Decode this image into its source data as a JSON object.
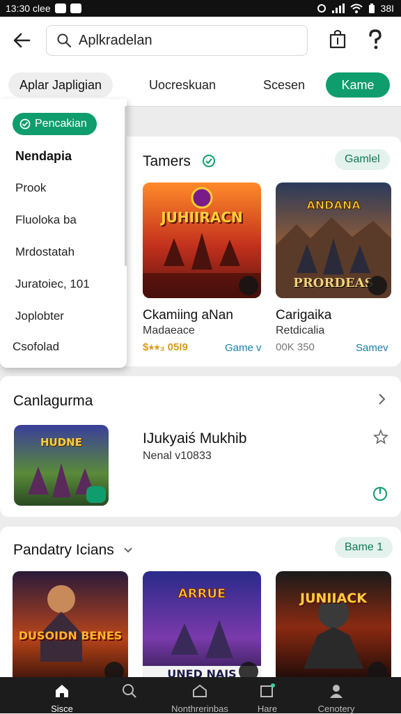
{
  "status": {
    "time": "13:30 clee",
    "battery": "38I"
  },
  "search": {
    "value": "Aplkradelan"
  },
  "tabs": [
    {
      "label": "Aplar Japligian"
    },
    {
      "label": "Uocreskuan"
    },
    {
      "label": "Scesen"
    },
    {
      "label": "Kame"
    }
  ],
  "dropdown": {
    "chip": "Pencakian",
    "items": [
      "Nendapia",
      "Prook",
      "Fluoloka ba",
      "Mrdostatah",
      "Juratoiec, 101",
      "Joplobter",
      "Csofolad"
    ]
  },
  "section1": {
    "title": "Tamers",
    "pill": "Gamlel",
    "games": [
      {
        "art": "JUHIIRACN",
        "title": "Ckamiing aNan",
        "subtitle": "Madaeace",
        "price": "$⭑⭑₃ 05I9",
        "tag": "Game v"
      },
      {
        "art": "PRORDEAS",
        "title": "Carigaika",
        "subtitle": "Retdicalia",
        "price": "00K 350",
        "tag": "Samev"
      }
    ]
  },
  "section2": {
    "title": "Canlagurma",
    "app": {
      "title": "IJukyaiś Mukhib",
      "subtitle": "Nenal v10833",
      "art": "HUDNE"
    }
  },
  "section3": {
    "title": "Pandatry Icians",
    "pill": "Bame 1",
    "games": [
      {
        "art": "DUSOIDN BENES"
      },
      {
        "art": "UNED NAIS"
      },
      {
        "art": "JUNIIACK"
      }
    ]
  },
  "nav": [
    {
      "label": "Sisce",
      "icon": "home-icon"
    },
    {
      "label": "",
      "icon": "search-icon"
    },
    {
      "label": "Nonthrerinbas",
      "icon": "store-icon"
    },
    {
      "label": "Hare",
      "icon": "tablet-icon"
    },
    {
      "label": "Cenotery",
      "icon": "people-icon"
    }
  ],
  "colors": {
    "accent": "#0f9d6e",
    "pill_bg": "#e3f2ec",
    "price": "#d99a1c",
    "tag": "#1a7fa8"
  }
}
